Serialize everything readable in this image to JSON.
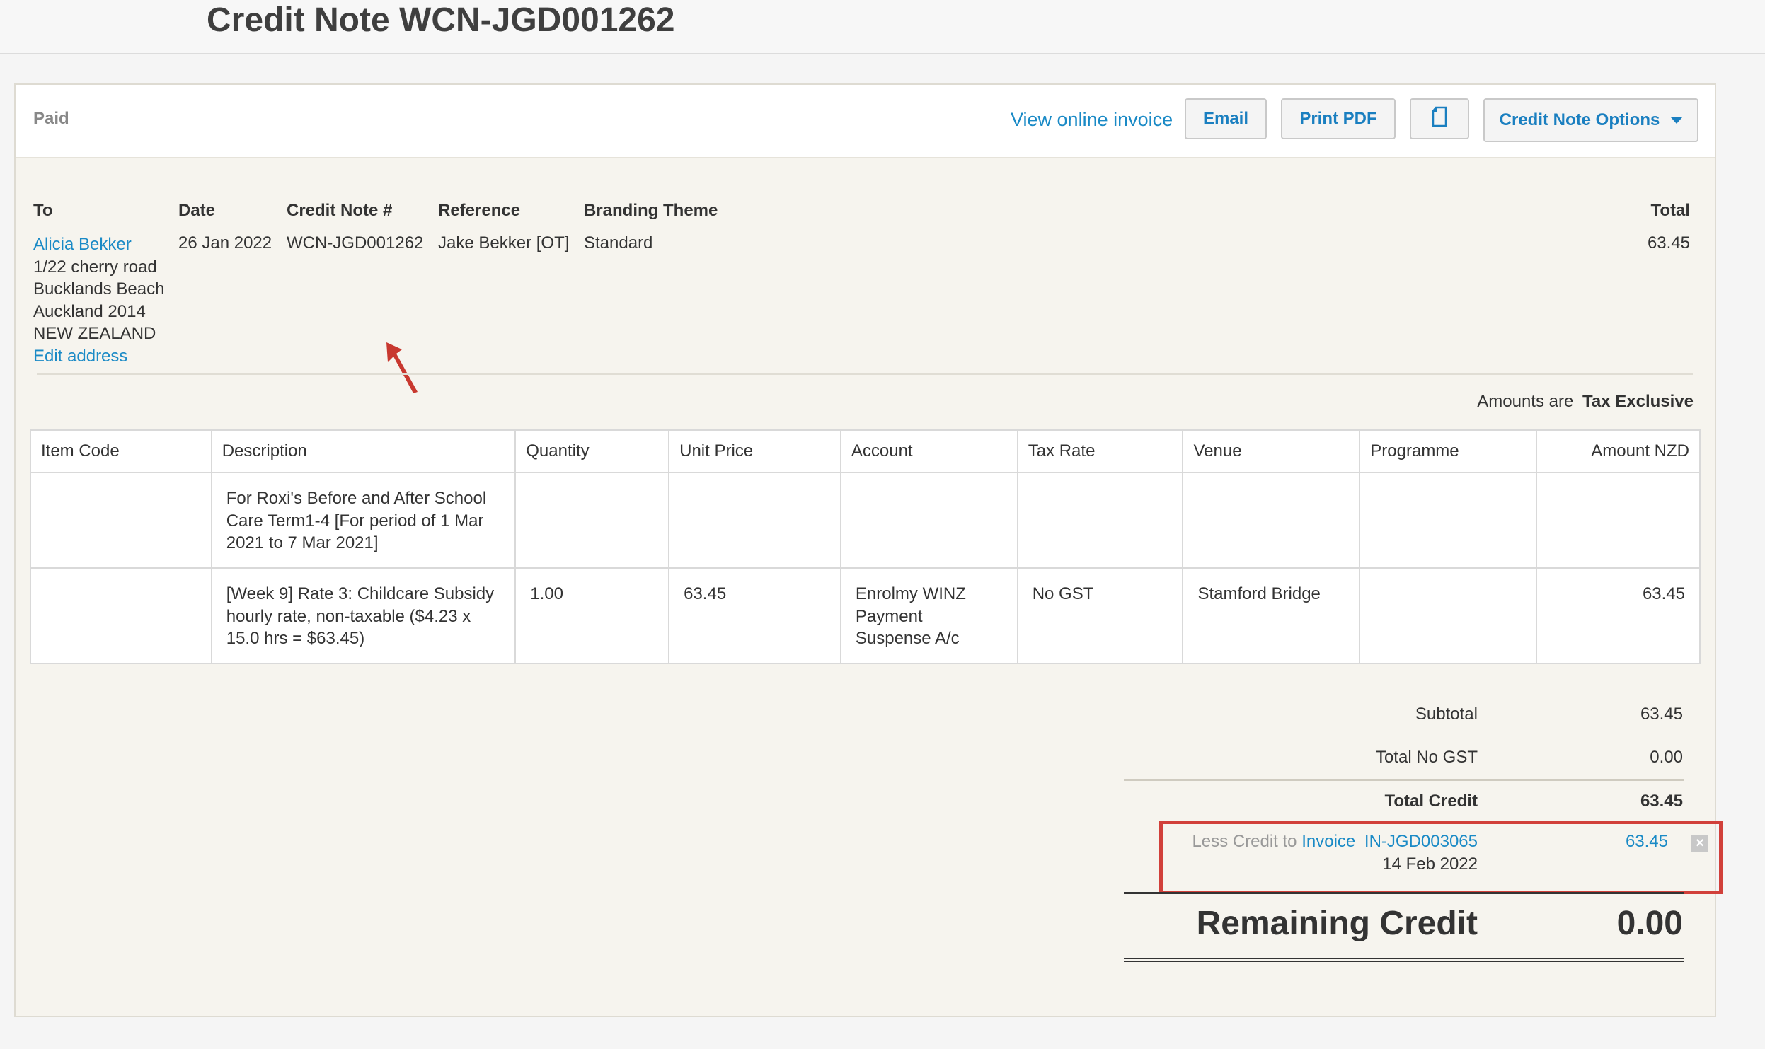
{
  "page": {
    "title": "Credit Note WCN-JGD001262"
  },
  "toolbar": {
    "status": "Paid",
    "view_online": "View online invoice",
    "email": "Email",
    "print_pdf": "Print PDF",
    "options": "Credit Note Options"
  },
  "details": {
    "headers": {
      "to": "To",
      "date": "Date",
      "credit_note_no": "Credit Note #",
      "reference": "Reference",
      "branding": "Branding Theme",
      "total": "Total"
    },
    "contact_name": "Alicia Bekker",
    "address_lines": [
      "1/22 cherry road",
      "Bucklands Beach",
      "Auckland 2014",
      "NEW ZEALAND"
    ],
    "edit_address": "Edit address",
    "date": "26 Jan 2022",
    "credit_note_no": "WCN-JGD001262",
    "reference": "Jake Bekker [OT]",
    "branding": "Standard",
    "total": "63.45"
  },
  "amounts_note": {
    "prefix": "Amounts are",
    "mode": "Tax Exclusive"
  },
  "table": {
    "columns": [
      "Item Code",
      "Description",
      "Quantity",
      "Unit Price",
      "Account",
      "Tax Rate",
      "Venue",
      "Programme",
      "Amount NZD"
    ],
    "rows": [
      {
        "item_code": "",
        "description": "For Roxi's Before and After School Care Term1-4 [For period of 1 Mar 2021 to 7 Mar 2021]",
        "quantity": "",
        "unit_price": "",
        "account": "",
        "tax_rate": "",
        "venue": "",
        "programme": "",
        "amount": ""
      },
      {
        "item_code": "",
        "description": "[Week 9] Rate 3: Childcare Subsidy hourly rate, non-taxable ($4.23 x 15.0 hrs = $63.45)",
        "quantity": "1.00",
        "unit_price": "63.45",
        "account": "Enrolmy WINZ Payment Suspense A/c",
        "tax_rate": "No GST",
        "venue": "Stamford Bridge",
        "programme": "",
        "amount": "63.45"
      }
    ]
  },
  "totals": {
    "subtotal_label": "Subtotal",
    "subtotal": "63.45",
    "no_gst_label": "Total No GST",
    "no_gst": "0.00",
    "total_credit_label": "Total Credit",
    "total_credit": "63.45",
    "less_credit_prefix": "Less Credit to",
    "less_credit_type": "Invoice",
    "less_credit_invoice": "IN-JGD003065",
    "less_credit_date": "14 Feb 2022",
    "less_credit_amount": "63.45",
    "remaining_label": "Remaining Credit",
    "remaining": "0.00"
  },
  "colors": {
    "link": "#1a8ac6",
    "highlight_box": "#d1403a",
    "annotation_arrow": "#c8382f"
  },
  "icons": {
    "copy": "copy-document-icon",
    "caret": "caret-down-icon",
    "remove": "close-icon"
  }
}
